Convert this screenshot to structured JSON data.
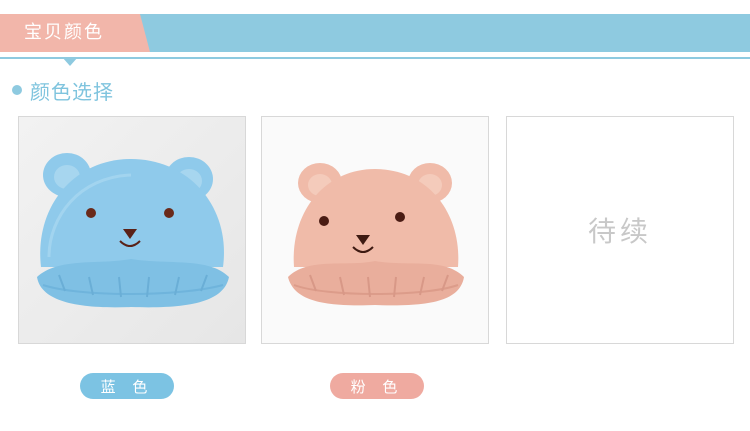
{
  "header": {
    "tab_label": "宝贝颜色"
  },
  "section": {
    "title": "颜色选择"
  },
  "colors": [
    {
      "label": "蓝 色",
      "swatch": "#7cc3e3",
      "product_color": "#8fcaeb"
    },
    {
      "label": "粉 色",
      "swatch": "#efaaa0",
      "product_color": "#f0bba9"
    }
  ],
  "placeholder": {
    "text": "待续"
  },
  "theme": {
    "accent": "#8ecae0",
    "tab_color": "#f2b6aa"
  }
}
